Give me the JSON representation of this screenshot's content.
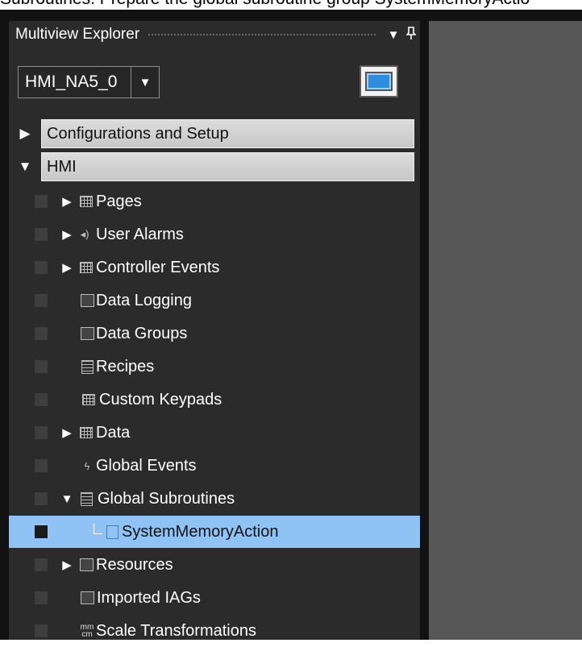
{
  "caption": "Subroutines. Prepare the global subroutine group SystemMemoryActio",
  "explorer": {
    "title": "Multiview Explorer",
    "dropdown_icon": "dropdown-arrow-icon",
    "pin_icon": "pin-icon"
  },
  "device": {
    "selected": "HMI_NA5_0",
    "arrow_icon": "chevron-down-icon",
    "screen_icon": "hmi-screen-icon"
  },
  "sections": [
    {
      "label": "Configurations and Setup",
      "state": "collapsed",
      "icon": "triangle-right-icon"
    },
    {
      "label": "HMI",
      "state": "expanded",
      "icon": "triangle-down-icon"
    }
  ],
  "tree": [
    {
      "label": "Pages",
      "expander": "▶",
      "icon": "pages-icon"
    },
    {
      "label": "User Alarms",
      "expander": "▶",
      "icon": "speaker-icon"
    },
    {
      "label": "Controller Events",
      "expander": "▶",
      "icon": "controller-events-icon"
    },
    {
      "label": "Data Logging",
      "expander": "",
      "icon": "data-logging-icon"
    },
    {
      "label": "Data Groups",
      "expander": "",
      "icon": "data-groups-icon"
    },
    {
      "label": "Recipes",
      "expander": "",
      "icon": "recipes-icon"
    },
    {
      "label": "Custom Keypads",
      "expander": "",
      "icon": "keypad-icon"
    },
    {
      "label": "Data",
      "expander": "▶",
      "icon": "data-icon"
    },
    {
      "label": "Global Events",
      "expander": "",
      "icon": "lightning-icon"
    },
    {
      "label": "Global Subroutines",
      "expander": "▼",
      "icon": "subroutines-icon"
    },
    {
      "label": "SystemMemoryAction",
      "expander": "",
      "icon": "subroutine-file-icon",
      "selected": true
    },
    {
      "label": "Resources",
      "expander": "▶",
      "icon": "resources-icon"
    },
    {
      "label": "Imported IAGs",
      "expander": "",
      "icon": "iag-icon"
    },
    {
      "label": "Scale Transformations",
      "expander": "",
      "icon": "scale-icon"
    }
  ],
  "colors": {
    "selection": "#8fc3f5",
    "panel": "#2b2b2b",
    "canvas": "#575757"
  }
}
